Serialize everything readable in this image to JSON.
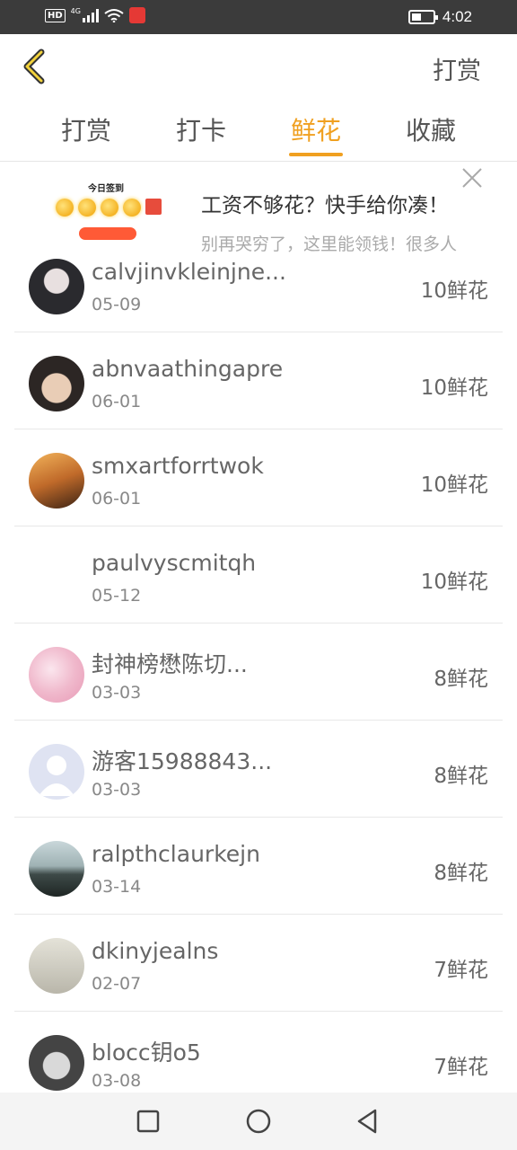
{
  "status_bar": {
    "hd": "HD",
    "network": "4G",
    "time": "4:02",
    "battery_level": 0.45
  },
  "header": {
    "action_label": "打赏"
  },
  "tabs": [
    {
      "label": "打赏",
      "active": false
    },
    {
      "label": "打卡",
      "active": false
    },
    {
      "label": "鲜花",
      "active": true
    },
    {
      "label": "收藏",
      "active": false
    }
  ],
  "ad": {
    "thumb_title": "今日签到",
    "title": "工资不够花？快手给你凑！",
    "subtitle": "别再哭穷了，这里能领钱！很多人"
  },
  "colors": {
    "accent": "#f0a020",
    "status_bar": "#3b3b3b"
  },
  "rows": [
    {
      "name": "calvjinvkleinjne...",
      "date": "05-09",
      "amount": "10鲜花"
    },
    {
      "name": "abnvaathingapre",
      "date": "06-01",
      "amount": "10鲜花"
    },
    {
      "name": "smxartforrtwok",
      "date": "06-01",
      "amount": "10鲜花"
    },
    {
      "name": "paulvyscmitqh",
      "date": "05-12",
      "amount": "10鲜花"
    },
    {
      "name": "封神榜懋陈切...",
      "date": "03-03",
      "amount": "8鲜花"
    },
    {
      "name": "游客15988843...",
      "date": "03-03",
      "amount": "8鲜花"
    },
    {
      "name": "ralpthclaurkejn",
      "date": "03-14",
      "amount": "8鲜花"
    },
    {
      "name": "dkinyjealns",
      "date": "02-07",
      "amount": "7鲜花"
    },
    {
      "name": "blocc钥o5",
      "date": "03-08",
      "amount": "7鲜花"
    }
  ]
}
